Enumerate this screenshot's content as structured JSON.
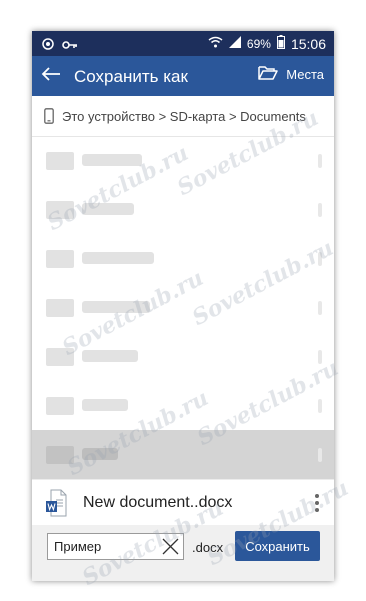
{
  "status_bar": {
    "battery_percent": "69%",
    "time": "15:06"
  },
  "app_bar": {
    "title": "Сохранить как",
    "places_label": "Места"
  },
  "breadcrumb": {
    "path": "Это устройство > SD-карта > Documents"
  },
  "blurred_rows_count_note": "",
  "file_item": {
    "name": "New document..docx"
  },
  "save_bar": {
    "filename_value": "Пример",
    "extension": ".docx",
    "save_label": "Сохранить"
  },
  "watermark": {
    "text": "Sovetclub.ru"
  },
  "colors": {
    "status_bar": "#1d2f5c",
    "app_bar": "#2b579a",
    "save_button": "#2b579a",
    "selected_row": "#d4d4d4"
  },
  "icons": [
    "back-arrow-icon",
    "folder-open-icon",
    "phone-device-icon",
    "word-document-icon",
    "close-icon",
    "more-vertical-icon",
    "wifi-icon",
    "signal-icon",
    "battery-icon",
    "key-icon"
  ]
}
